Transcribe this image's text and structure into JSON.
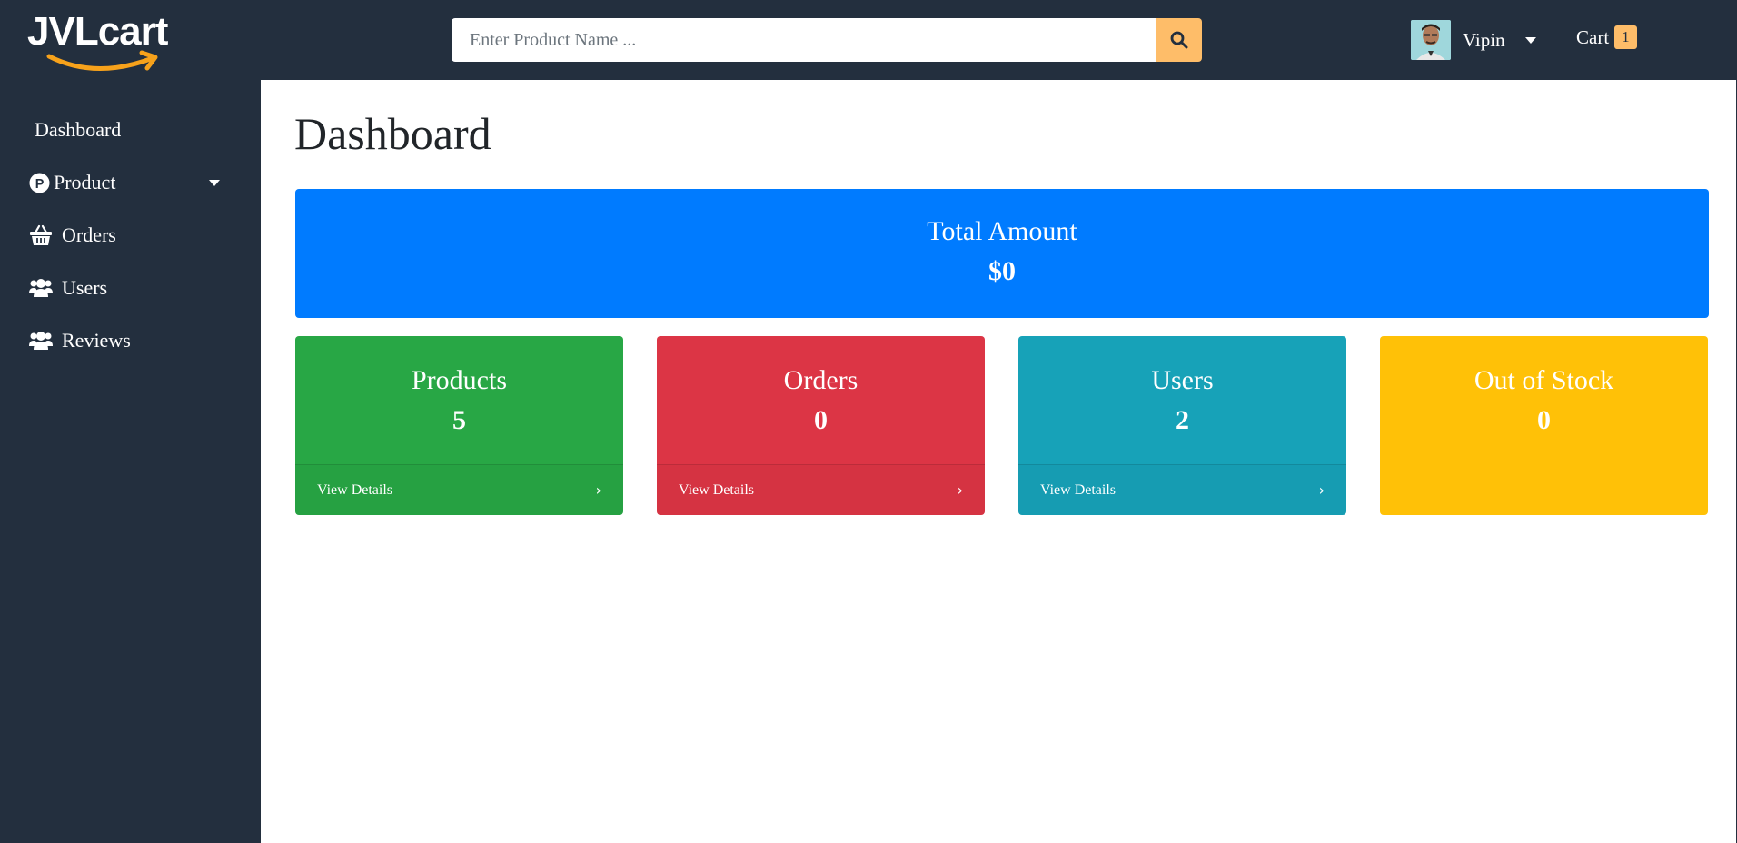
{
  "header": {
    "logo_text": "JVLcart",
    "search": {
      "placeholder": "Enter Product Name ...",
      "value": ""
    },
    "user": {
      "name": "Vipin"
    },
    "cart": {
      "label": "Cart",
      "count": "1"
    }
  },
  "sidebar": {
    "items": [
      {
        "label": "Dashboard",
        "icon": "dashboard-icon"
      },
      {
        "label": "Product",
        "icon": "product-p-icon"
      },
      {
        "label": "Orders",
        "icon": "basket-icon"
      },
      {
        "label": "Users",
        "icon": "users-icon"
      },
      {
        "label": "Reviews",
        "icon": "users-icon"
      }
    ]
  },
  "main": {
    "title": "Dashboard",
    "total": {
      "title": "Total Amount",
      "value": "$0"
    },
    "cards": [
      {
        "title": "Products",
        "value": "5",
        "footer": "View Details",
        "color": "#28a745"
      },
      {
        "title": "Orders",
        "value": "0",
        "footer": "View Details",
        "color": "#dc3545"
      },
      {
        "title": "Users",
        "value": "2",
        "footer": "View Details",
        "color": "#17a2b8"
      },
      {
        "title": "Out of Stock",
        "value": "0",
        "color": "#ffc107"
      }
    ]
  },
  "colors": {
    "navbar": "#232f3e",
    "accent": "#febd69",
    "primary": "#007bff"
  }
}
